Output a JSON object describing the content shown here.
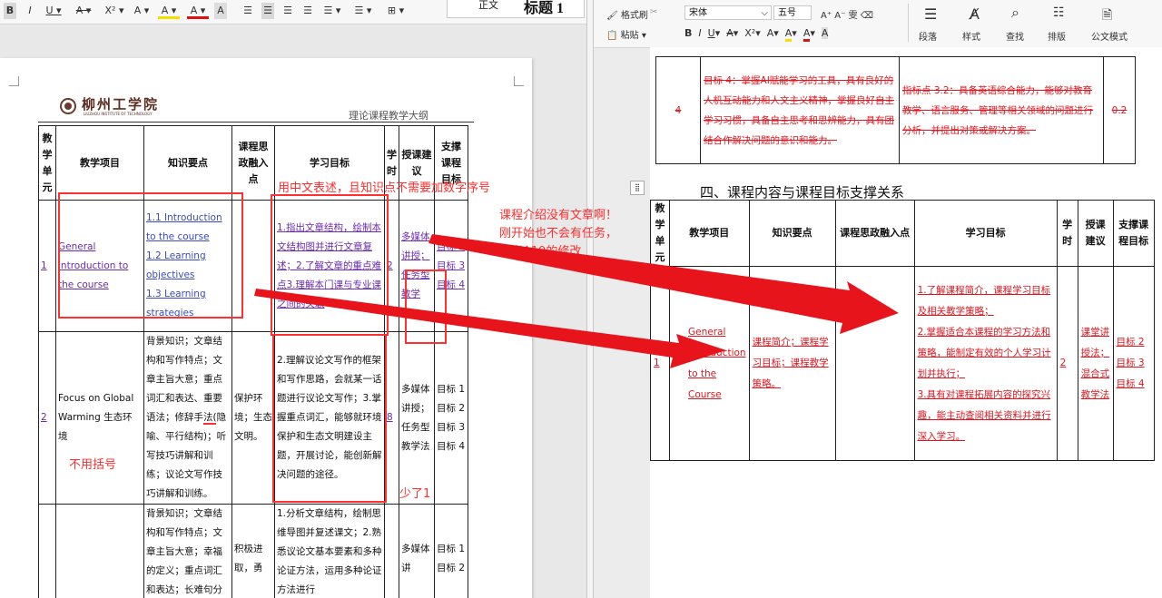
{
  "left_toolbar": {
    "buttons": [
      "B",
      "I",
      "U ▾",
      "A ▾",
      "X² ▾",
      "A ▾",
      "A ▾",
      "A ▾",
      "A",
      "☰",
      "☰",
      "☰",
      "☰",
      "☰ ▾",
      "☰ ▾",
      "⊞ ▾"
    ],
    "style_normal": "正文",
    "style_heading": "标题 1"
  },
  "left_doc": {
    "logo_cn": "柳州工学院",
    "logo_en": "LIUZHOU INSTITUTE OF TECHNOLOGY",
    "doc_header": "理论课程教学大纲",
    "headers": [
      "教学单元",
      "教学项目",
      "知识要点",
      "课程思政融入点",
      "学习目标",
      "学时",
      "授课建议",
      "支撑课程目标"
    ],
    "rows": [
      {
        "unit": "1",
        "project": "General introduction to the course",
        "knowledge": [
          "1.1 Introduction to the course",
          "1.2 Learning objectives",
          "1.3 Learning strategies"
        ],
        "ideology": "",
        "goals": "1.指出文章结构，绘制本文结构图并进行文章复述；2.了解文章的重点难点3.理解本门课与专业课之间的关联",
        "hours": "2",
        "suggest": "多媒体讲授；任务型教学",
        "support": [
          "目标 2",
          "目标 3",
          "目标 4"
        ]
      },
      {
        "unit": "2",
        "project": "Focus on Global Warming 生态环境",
        "knowledge": "背景知识；文章结构和写作特点；文章主旨大意；重点词汇和表达、重要语法；修辞手法(隐喻、平行结构)；听写技巧讲解和训练；议论文写作技巧讲解和训练。",
        "ideology": "保护环境；生态文明。",
        "goals": "2.理解议论文写作的框架和写作思路，会就某一话题进行议论文写作；3.掌握重点词汇，能够就环境保护和生态文明建设主题，开展讨论，能创新解决问题的途径。",
        "hours": "8",
        "suggest": "多媒体讲授；任务型教学法",
        "support": [
          "目标 1",
          "目标 2",
          "目标 3",
          "目标 4"
        ]
      },
      {
        "unit": "",
        "project": "",
        "knowledge": "背景知识；文章结构和写作特点；文章主旨大意；幸福的定义；重点词汇和表达；长难句分",
        "ideology": "积极进取，勇",
        "goals": "1.分析文章结构，绘制思维导图并复述课文；2.熟悉议论文基本要素和多种论证方法，运用多种论证方法进行",
        "hours": "",
        "suggest": "多媒体讲",
        "support": [
          "目标 1",
          "目标 2"
        ]
      }
    ]
  },
  "annotations": {
    "a1": "用中文表述，且知识点不需要加数字序号",
    "a2_line1": "课程介绍没有文章啊！",
    "a2_line2": "刚开始也不会有任务，",
    "a2_line3": "参考A19的修改",
    "a3": "不用括号",
    "a4": "少了1"
  },
  "right_toolbar": {
    "format_painter": "格式刷",
    "paste": "粘贴",
    "font_name": "宋体",
    "font_size": "五号",
    "paragraph": "段落",
    "styles": "样式",
    "find": "查找",
    "layout": "排版",
    "convert": "公文模式"
  },
  "right_doc": {
    "prev_row": {
      "num": "4",
      "goal": "目标 4：掌握AI赋能学习的工具，具有良好的人机互动能力和人文主义精神，掌握良好自主学习习惯，具备自主思考和思辨能力，具有团结合作解决问题的意识和能力。",
      "indicator": "指标点 3.2：具备英语综合能力，能够对教育教学、语言服务、管理等相关领域的问题进行分析，并提出对策或解决方案。",
      "weight": "0.2"
    },
    "section_title": "四、课程内容与课程目标支撑关系",
    "headers": [
      "教学单元",
      "教学项目",
      "知识要点",
      "课程思政融入点",
      "学习目标",
      "学时",
      "授课建议",
      "支撑课程目标"
    ],
    "row": {
      "unit": "1",
      "project": "General Introduction to the Course",
      "knowledge": "课程简介；课程学习目标；课程教学策略。",
      "ideology": "",
      "goals": [
        "1.了解课程简介，课程学习目标及相关教学策略；",
        "2.掌握适合本课程的学习方法和策略，能制定有效的个人学习计划并执行；",
        "3.具有对课程拓展内容的探究兴趣，能主动查阅相关资料并进行深入学习。"
      ],
      "hours": "2",
      "suggest": "课堂讲授法；混合式教学法",
      "support": [
        "目标 2",
        "目标 3",
        "目标 4"
      ]
    }
  }
}
